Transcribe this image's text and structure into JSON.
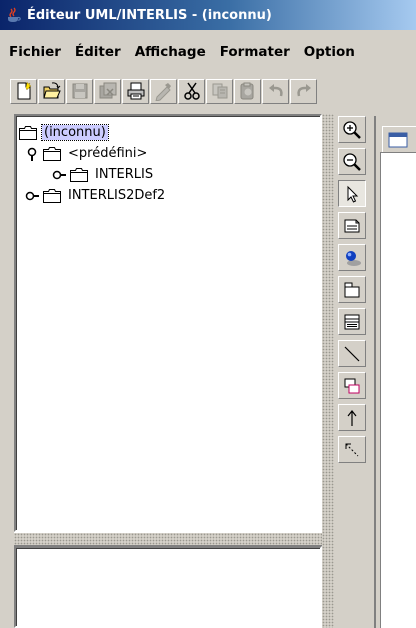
{
  "window": {
    "title": "Éditeur UML/INTERLIS - (inconnu)",
    "icon": "java-cup-icon"
  },
  "menubar": {
    "items": [
      "Fichier",
      "Éditer",
      "Affichage",
      "Formater",
      "Option"
    ]
  },
  "toolbar": {
    "buttons": [
      {
        "icon": "new-file-icon",
        "enabled": true
      },
      {
        "icon": "open-folder-icon",
        "enabled": true
      },
      {
        "icon": "save-icon",
        "enabled": false
      },
      {
        "icon": "save-all-icon",
        "enabled": false
      },
      {
        "icon": "print-icon",
        "enabled": true
      },
      {
        "icon": "pen-icon",
        "enabled": false
      },
      {
        "icon": "cut-icon",
        "enabled": false
      },
      {
        "icon": "copy-icon",
        "enabled": false
      },
      {
        "icon": "paste-icon",
        "enabled": false
      },
      {
        "icon": "undo-icon",
        "enabled": false
      },
      {
        "icon": "redo-icon",
        "enabled": false
      }
    ]
  },
  "tree": {
    "root": {
      "label": "(inconnu)",
      "selected": true
    },
    "nodes": [
      {
        "label": "<prédéfini>",
        "expanded": true
      },
      {
        "label": "INTERLIS",
        "expanded": false
      },
      {
        "label": "INTERLIS2Def2",
        "expanded": false
      }
    ]
  },
  "palette": {
    "tools": [
      {
        "icon": "zoom-in-icon",
        "pressed": false
      },
      {
        "icon": "zoom-out-icon",
        "pressed": false
      },
      {
        "icon": "select-arrow-icon",
        "pressed": true
      },
      {
        "icon": "note-icon",
        "pressed": false
      },
      {
        "icon": "actor-icon",
        "pressed": false
      },
      {
        "icon": "package-icon",
        "pressed": false
      },
      {
        "icon": "class-icon",
        "pressed": false
      },
      {
        "icon": "association-line-icon",
        "pressed": false
      },
      {
        "icon": "composition-icon",
        "pressed": false
      },
      {
        "icon": "generalization-arrow-icon",
        "pressed": false
      },
      {
        "icon": "dependency-arrow-icon",
        "pressed": false
      }
    ]
  },
  "colors": {
    "titlebar_start": "#0a246a",
    "titlebar_end": "#a6caf0",
    "chrome": "#d4d0c8",
    "selection": "#ccccff"
  }
}
